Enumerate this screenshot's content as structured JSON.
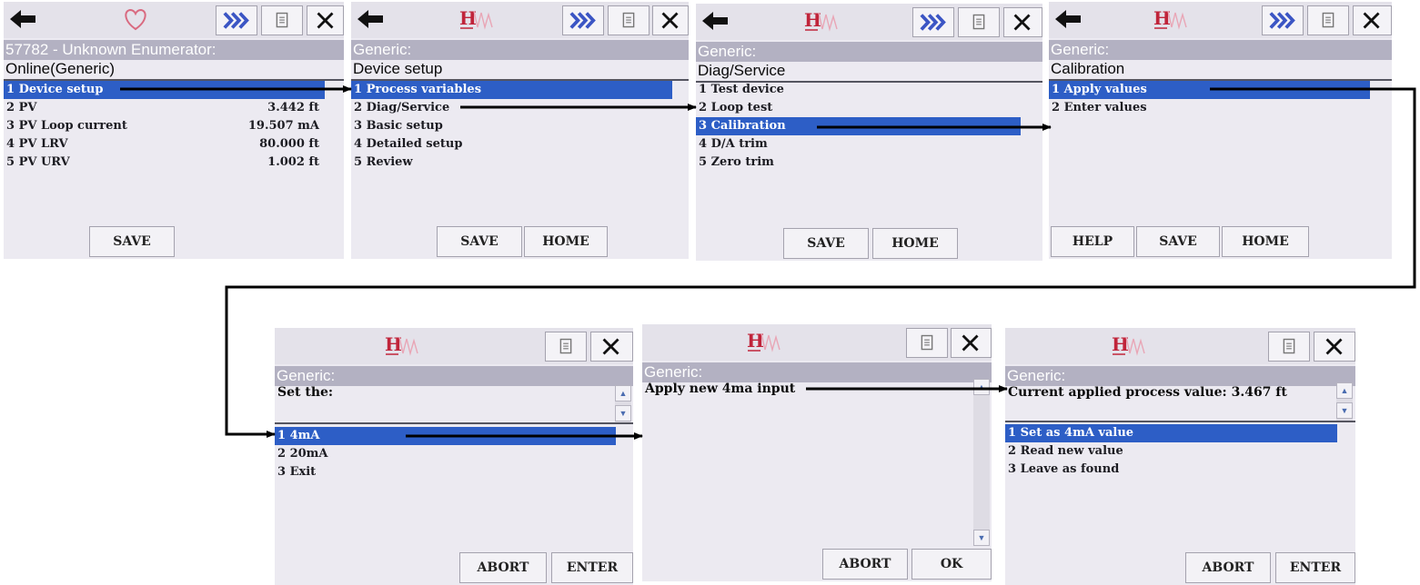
{
  "colors": {
    "selection": "#2d5ec6",
    "header_bar": "#b3b1c2",
    "screen_bg": "#eceaf1",
    "arrow": "#000000",
    "logo_h": "#c0243a",
    "logo_wave": "#e9a6b6",
    "forward_icon": "#3b55c4"
  },
  "icons": {
    "back": "left-arrow-icon",
    "favorite": "heart-icon",
    "forward": "forward-chevrons-icon",
    "document": "document-icon",
    "close": "close-icon",
    "logo": "hart-logo",
    "scroll_up": "scroll-up-icon",
    "scroll_down": "scroll-down-icon"
  },
  "screen1": {
    "title": "57782 - Unknown Enumerator:",
    "subtitle": "Online(Generic)",
    "items": [
      {
        "label": "1 Device setup",
        "value": ""
      },
      {
        "label": "2 PV",
        "value": "3.442 ft"
      },
      {
        "label": "3 PV Loop current",
        "value": "19.507 mA"
      },
      {
        "label": "4 PV LRV",
        "value": "80.000 ft"
      },
      {
        "label": "5 PV URV",
        "value": "1.002 ft"
      }
    ],
    "save": "SAVE"
  },
  "screen2": {
    "title": "Generic:",
    "subtitle": "Device setup",
    "items": [
      "1 Process variables",
      "2 Diag/Service",
      "3 Basic setup",
      "4 Detailed setup",
      "5 Review"
    ],
    "save": "SAVE",
    "home": "HOME"
  },
  "screen3": {
    "title": "Generic:",
    "subtitle": "Diag/Service",
    "items": [
      "1 Test device",
      "2 Loop test",
      "3 Calibration",
      "4 D/A trim",
      "5 Zero trim"
    ],
    "save": "SAVE",
    "home": "HOME"
  },
  "screen4": {
    "title": "Generic:",
    "subtitle": "Calibration",
    "items": [
      "1 Apply values",
      "2 Enter values"
    ],
    "help": "HELP",
    "save": "SAVE",
    "home": "HOME"
  },
  "screen5": {
    "title": "Generic:",
    "prompt": "Set the:",
    "items": [
      "1 4mA",
      "2 20mA",
      "3 Exit"
    ],
    "abort": "ABORT",
    "enter": "ENTER"
  },
  "screen6": {
    "title": "Generic:",
    "prompt": "Apply new 4ma input",
    "abort": "ABORT",
    "ok": "OK"
  },
  "screen7": {
    "title": "Generic:",
    "prompt": "Current applied process value: 3.467 ft",
    "items": [
      "1 Set as 4mA value",
      "2 Read new value",
      "3 Leave as found"
    ],
    "abort": "ABORT",
    "enter": "ENTER"
  }
}
